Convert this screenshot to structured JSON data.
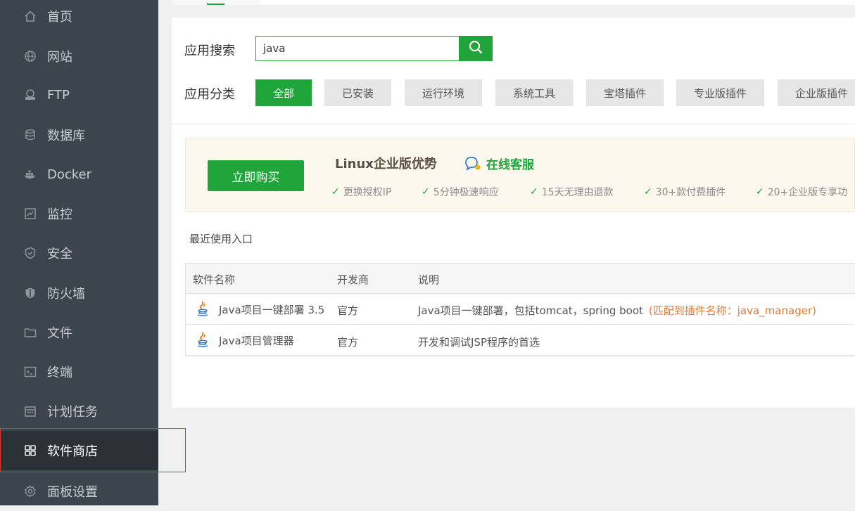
{
  "sidebar": {
    "items": [
      {
        "label": "首页",
        "icon": "home-icon"
      },
      {
        "label": "网站",
        "icon": "globe-icon"
      },
      {
        "label": "FTP",
        "icon": "ftp-icon"
      },
      {
        "label": "数据库",
        "icon": "database-icon"
      },
      {
        "label": "Docker",
        "icon": "docker-icon"
      },
      {
        "label": "监控",
        "icon": "monitor-icon"
      },
      {
        "label": "安全",
        "icon": "shield-check-icon"
      },
      {
        "label": "防火墙",
        "icon": "firewall-shield-icon"
      },
      {
        "label": "文件",
        "icon": "folder-icon"
      },
      {
        "label": "终端",
        "icon": "terminal-icon"
      },
      {
        "label": "计划任务",
        "icon": "calendar-icon"
      },
      {
        "label": "软件商店",
        "icon": "grid-apps-icon",
        "active": true
      },
      {
        "label": "面板设置",
        "icon": "gear-icon"
      }
    ]
  },
  "search": {
    "label": "应用搜索",
    "value": "java"
  },
  "category": {
    "label": "应用分类",
    "items": [
      "全部",
      "已安装",
      "运行环境",
      "系统工具",
      "宝塔插件",
      "专业版插件",
      "企业版插件"
    ],
    "selected": "全部"
  },
  "promo": {
    "buy_label": "立即购买",
    "title": "Linux企业版优势",
    "service_label": "在线客服",
    "features": [
      "更换授权IP",
      "5分钟极速响应",
      "15天无理由退款",
      "30+款付费插件",
      "20+企业版专享功"
    ]
  },
  "recent_label": "最近使用入口",
  "table": {
    "headers": [
      "软件名称",
      "开发商",
      "说明"
    ],
    "rows": [
      {
        "name": "Java项目一键部署 3.5",
        "vendor": "官方",
        "desc": "Java项目一键部署，包括tomcat，spring boot",
        "match": "(匹配到插件名称：java_manager)"
      },
      {
        "name": "Java项目管理器",
        "vendor": "官方",
        "desc": "开发和调试JSP程序的首选",
        "match": ""
      }
    ]
  },
  "colors": {
    "accent": "#20a53a",
    "sidebar_bg": "#3c444d",
    "highlight": "#d33a36",
    "match_text": "#e07b39"
  }
}
